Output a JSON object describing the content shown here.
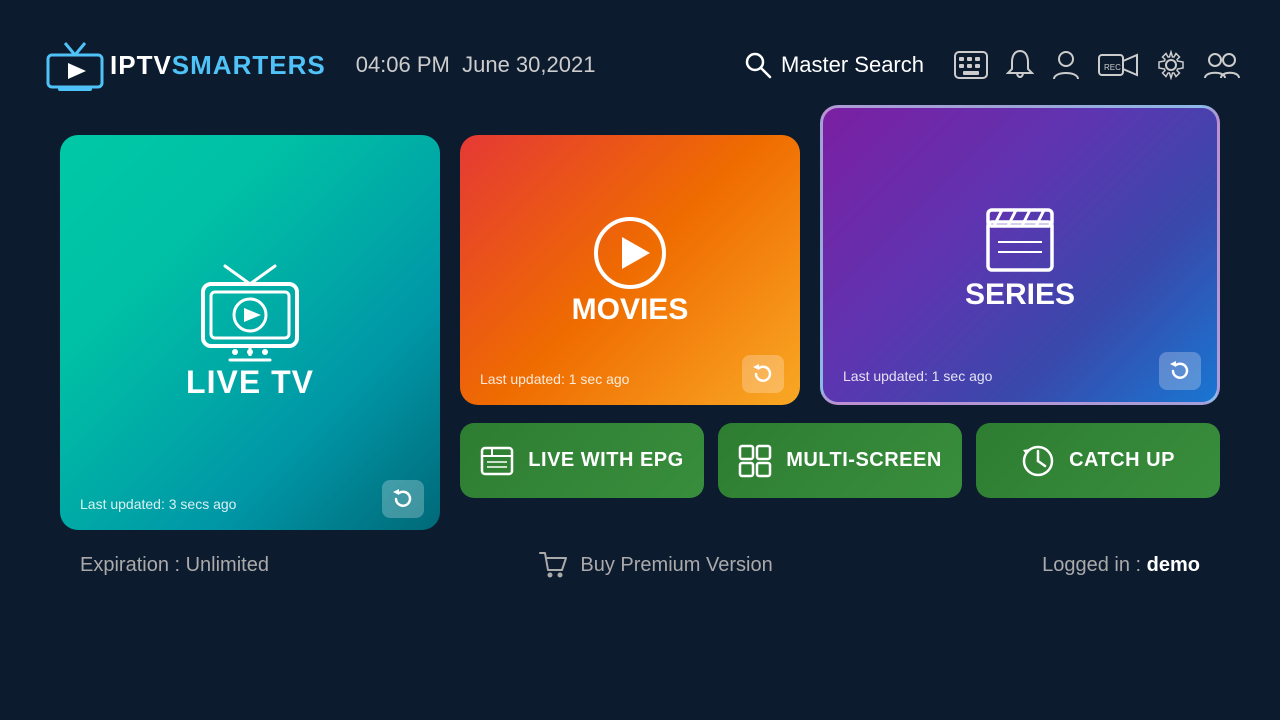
{
  "header": {
    "logo_iptv": "IPTV",
    "logo_smarters": "SMARTERS",
    "time": "04:06 PM",
    "date": "June 30,2021",
    "search_label": "Master Search",
    "icons": {
      "keyboard": "⌨",
      "bell": "🔔",
      "user": "👤",
      "rec": "⏺",
      "settings": "⚙",
      "switch_user": "👥"
    }
  },
  "cards": {
    "live_tv": {
      "title": "LIVE TV",
      "last_updated": "Last updated: 3 secs ago",
      "refresh_icon": "↻"
    },
    "movies": {
      "title": "MOVIES",
      "last_updated": "Last updated: 1 sec ago",
      "refresh_icon": "↻"
    },
    "series": {
      "title": "SERIES",
      "last_updated": "Last updated: 1 sec ago",
      "refresh_icon": "↻"
    }
  },
  "buttons": {
    "live_epg": {
      "label": "LIVE WITH EPG",
      "icon": "📖"
    },
    "multi_screen": {
      "label": "MULTI-SCREEN",
      "icon": "⊞"
    },
    "catch_up": {
      "label": "CATCH UP",
      "icon": "🕐"
    }
  },
  "footer": {
    "expiry_label": "Expiration : Unlimited",
    "buy_premium_label": "Buy Premium Version",
    "logged_in_prefix": "Logged in : ",
    "username": "demo"
  }
}
